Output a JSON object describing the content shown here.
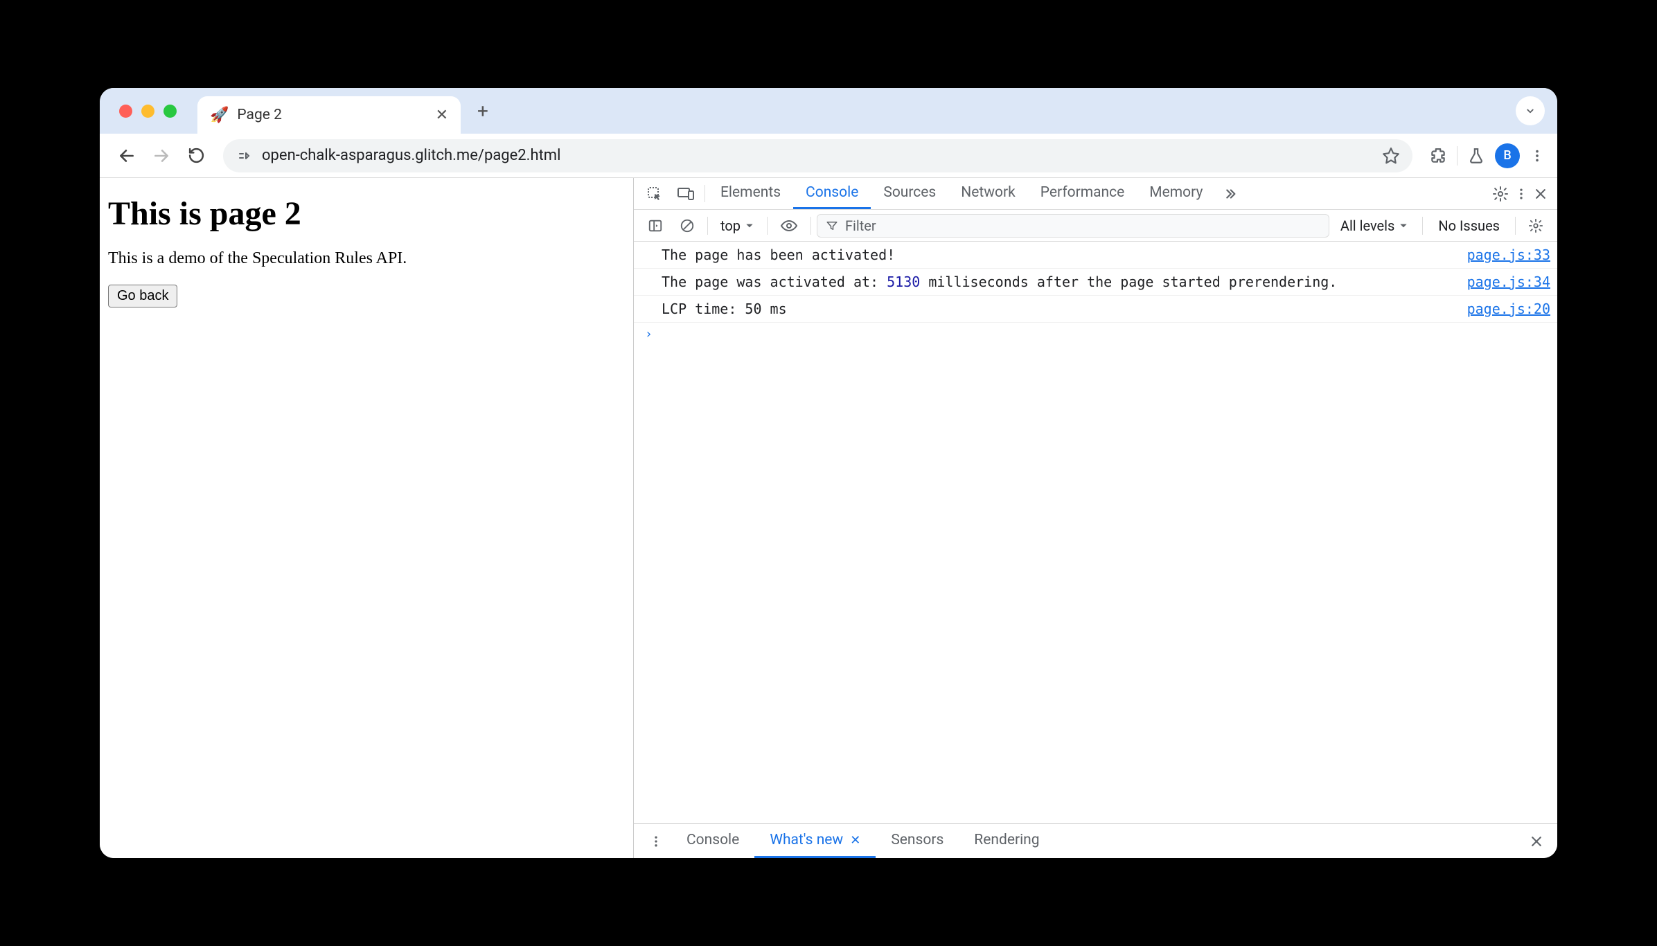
{
  "browser": {
    "tab": {
      "favicon": "🚀",
      "title": "Page 2"
    },
    "url": "open-chalk-asparagus.glitch.me/page2.html",
    "avatar_initial": "B"
  },
  "page": {
    "heading": "This is page 2",
    "paragraph": "This is a demo of the Speculation Rules API.",
    "button": "Go back"
  },
  "devtools": {
    "tabs": [
      "Elements",
      "Console",
      "Sources",
      "Network",
      "Performance",
      "Memory"
    ],
    "active_tab": "Console",
    "console_toolbar": {
      "context": "top",
      "filter_placeholder": "Filter",
      "levels": "All levels",
      "issues": "No Issues"
    },
    "messages": [
      {
        "text": "The page has been activated!",
        "source": "page.js:33"
      },
      {
        "text_pre": "The page was activated at: ",
        "num": "5130",
        "text_post": "  milliseconds after the page started prerendering.",
        "source": "page.js:34"
      },
      {
        "text": "LCP time: 50 ms",
        "source": "page.js:20"
      }
    ],
    "drawer_tabs": [
      "Console",
      "What's new",
      "Sensors",
      "Rendering"
    ],
    "drawer_active": "What's new"
  }
}
